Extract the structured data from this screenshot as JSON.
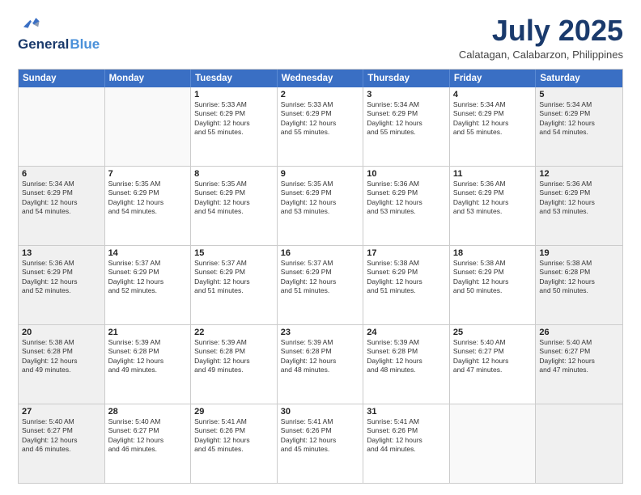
{
  "header": {
    "logo_line1": "General",
    "logo_line2": "Blue",
    "month": "July 2025",
    "location": "Calatagan, Calabarzon, Philippines"
  },
  "weekdays": [
    "Sunday",
    "Monday",
    "Tuesday",
    "Wednesday",
    "Thursday",
    "Friday",
    "Saturday"
  ],
  "rows": [
    [
      {
        "day": "",
        "info": "",
        "empty": true
      },
      {
        "day": "",
        "info": "",
        "empty": true
      },
      {
        "day": "1",
        "info": "Sunrise: 5:33 AM\nSunset: 6:29 PM\nDaylight: 12 hours\nand 55 minutes."
      },
      {
        "day": "2",
        "info": "Sunrise: 5:33 AM\nSunset: 6:29 PM\nDaylight: 12 hours\nand 55 minutes."
      },
      {
        "day": "3",
        "info": "Sunrise: 5:34 AM\nSunset: 6:29 PM\nDaylight: 12 hours\nand 55 minutes."
      },
      {
        "day": "4",
        "info": "Sunrise: 5:34 AM\nSunset: 6:29 PM\nDaylight: 12 hours\nand 55 minutes."
      },
      {
        "day": "5",
        "info": "Sunrise: 5:34 AM\nSunset: 6:29 PM\nDaylight: 12 hours\nand 54 minutes.",
        "shaded": true
      }
    ],
    [
      {
        "day": "6",
        "info": "Sunrise: 5:34 AM\nSunset: 6:29 PM\nDaylight: 12 hours\nand 54 minutes.",
        "shaded": true
      },
      {
        "day": "7",
        "info": "Sunrise: 5:35 AM\nSunset: 6:29 PM\nDaylight: 12 hours\nand 54 minutes."
      },
      {
        "day": "8",
        "info": "Sunrise: 5:35 AM\nSunset: 6:29 PM\nDaylight: 12 hours\nand 54 minutes."
      },
      {
        "day": "9",
        "info": "Sunrise: 5:35 AM\nSunset: 6:29 PM\nDaylight: 12 hours\nand 53 minutes."
      },
      {
        "day": "10",
        "info": "Sunrise: 5:36 AM\nSunset: 6:29 PM\nDaylight: 12 hours\nand 53 minutes."
      },
      {
        "day": "11",
        "info": "Sunrise: 5:36 AM\nSunset: 6:29 PM\nDaylight: 12 hours\nand 53 minutes."
      },
      {
        "day": "12",
        "info": "Sunrise: 5:36 AM\nSunset: 6:29 PM\nDaylight: 12 hours\nand 53 minutes.",
        "shaded": true
      }
    ],
    [
      {
        "day": "13",
        "info": "Sunrise: 5:36 AM\nSunset: 6:29 PM\nDaylight: 12 hours\nand 52 minutes.",
        "shaded": true
      },
      {
        "day": "14",
        "info": "Sunrise: 5:37 AM\nSunset: 6:29 PM\nDaylight: 12 hours\nand 52 minutes."
      },
      {
        "day": "15",
        "info": "Sunrise: 5:37 AM\nSunset: 6:29 PM\nDaylight: 12 hours\nand 51 minutes."
      },
      {
        "day": "16",
        "info": "Sunrise: 5:37 AM\nSunset: 6:29 PM\nDaylight: 12 hours\nand 51 minutes."
      },
      {
        "day": "17",
        "info": "Sunrise: 5:38 AM\nSunset: 6:29 PM\nDaylight: 12 hours\nand 51 minutes."
      },
      {
        "day": "18",
        "info": "Sunrise: 5:38 AM\nSunset: 6:29 PM\nDaylight: 12 hours\nand 50 minutes."
      },
      {
        "day": "19",
        "info": "Sunrise: 5:38 AM\nSunset: 6:28 PM\nDaylight: 12 hours\nand 50 minutes.",
        "shaded": true
      }
    ],
    [
      {
        "day": "20",
        "info": "Sunrise: 5:38 AM\nSunset: 6:28 PM\nDaylight: 12 hours\nand 49 minutes.",
        "shaded": true
      },
      {
        "day": "21",
        "info": "Sunrise: 5:39 AM\nSunset: 6:28 PM\nDaylight: 12 hours\nand 49 minutes."
      },
      {
        "day": "22",
        "info": "Sunrise: 5:39 AM\nSunset: 6:28 PM\nDaylight: 12 hours\nand 49 minutes."
      },
      {
        "day": "23",
        "info": "Sunrise: 5:39 AM\nSunset: 6:28 PM\nDaylight: 12 hours\nand 48 minutes."
      },
      {
        "day": "24",
        "info": "Sunrise: 5:39 AM\nSunset: 6:28 PM\nDaylight: 12 hours\nand 48 minutes."
      },
      {
        "day": "25",
        "info": "Sunrise: 5:40 AM\nSunset: 6:27 PM\nDaylight: 12 hours\nand 47 minutes."
      },
      {
        "day": "26",
        "info": "Sunrise: 5:40 AM\nSunset: 6:27 PM\nDaylight: 12 hours\nand 47 minutes.",
        "shaded": true
      }
    ],
    [
      {
        "day": "27",
        "info": "Sunrise: 5:40 AM\nSunset: 6:27 PM\nDaylight: 12 hours\nand 46 minutes.",
        "shaded": true
      },
      {
        "day": "28",
        "info": "Sunrise: 5:40 AM\nSunset: 6:27 PM\nDaylight: 12 hours\nand 46 minutes."
      },
      {
        "day": "29",
        "info": "Sunrise: 5:41 AM\nSunset: 6:26 PM\nDaylight: 12 hours\nand 45 minutes."
      },
      {
        "day": "30",
        "info": "Sunrise: 5:41 AM\nSunset: 6:26 PM\nDaylight: 12 hours\nand 45 minutes."
      },
      {
        "day": "31",
        "info": "Sunrise: 5:41 AM\nSunset: 6:26 PM\nDaylight: 12 hours\nand 44 minutes."
      },
      {
        "day": "",
        "info": "",
        "empty": true
      },
      {
        "day": "",
        "info": "",
        "empty": true,
        "shaded": true
      }
    ]
  ]
}
